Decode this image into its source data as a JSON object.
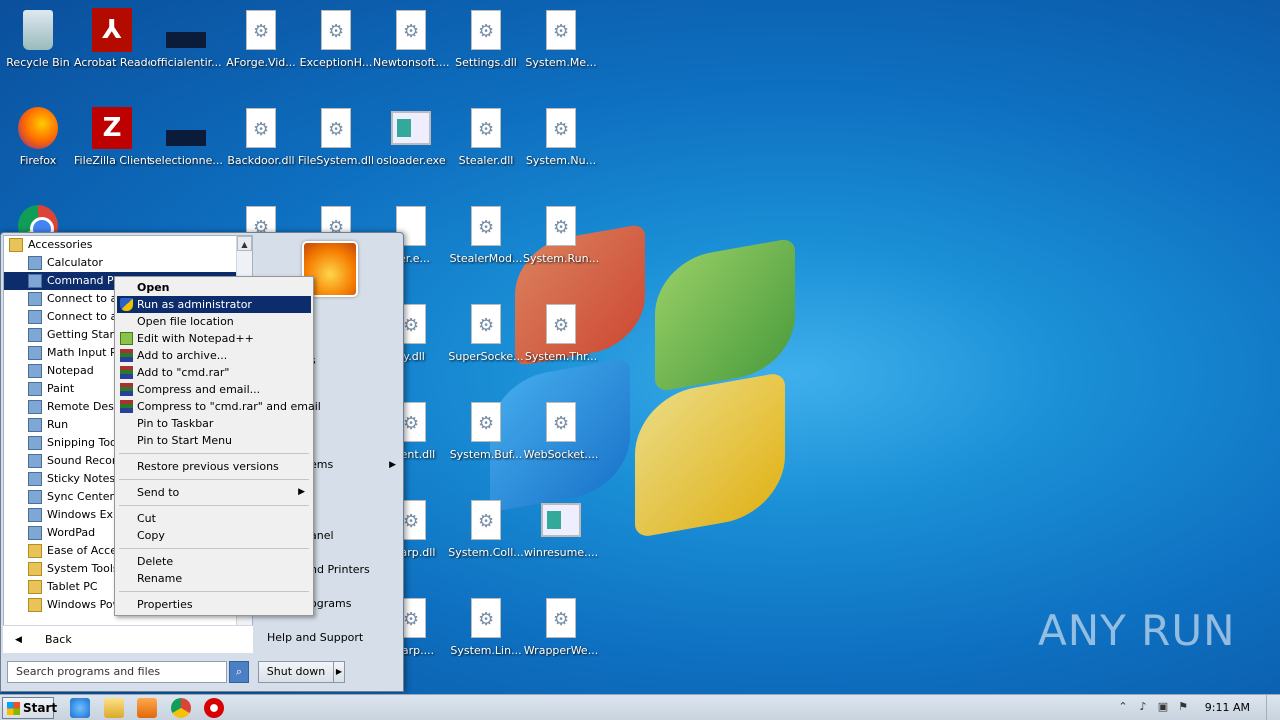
{
  "desktop": {
    "icons": [
      {
        "label": "Recycle Bin",
        "icon": "recycle-bin-icon",
        "kind": "bin"
      },
      {
        "label": "Acrobat Reader DC",
        "icon": "acrobat-icon",
        "kind": "pdf"
      },
      {
        "label": "officialentir...",
        "icon": "file-icon",
        "kind": "dark"
      },
      {
        "label": "AForge.Vid...",
        "icon": "dll-icon",
        "kind": "dll"
      },
      {
        "label": "ExceptionH...",
        "icon": "dll-icon",
        "kind": "dll"
      },
      {
        "label": "Newtonsoft....",
        "icon": "dll-icon",
        "kind": "dll"
      },
      {
        "label": "Settings.dll",
        "icon": "dll-icon",
        "kind": "dll"
      },
      {
        "label": "System.Me...",
        "icon": "dll-icon",
        "kind": "dll"
      },
      {
        "label": "Firefox",
        "icon": "firefox-icon",
        "kind": "ff"
      },
      {
        "label": "FileZilla Client",
        "icon": "filezilla-icon",
        "kind": "fz"
      },
      {
        "label": "selectionne...",
        "icon": "file-icon",
        "kind": "dark"
      },
      {
        "label": "Backdoor.dll",
        "icon": "dll-icon",
        "kind": "dll"
      },
      {
        "label": "FileSystem.dll",
        "icon": "dll-icon",
        "kind": "dll"
      },
      {
        "label": "osloader.exe",
        "icon": "exe-icon",
        "kind": "exe"
      },
      {
        "label": "Stealer.dll",
        "icon": "dll-icon",
        "kind": "dll"
      },
      {
        "label": "System.Nu...",
        "icon": "dll-icon",
        "kind": "dll"
      },
      {
        "label": "",
        "icon": "chrome-icon",
        "kind": "chrome"
      },
      {
        "label": "",
        "icon": "dll-icon",
        "kind": "dll"
      },
      {
        "label": "",
        "icon": "dll-icon",
        "kind": "dll"
      },
      {
        "label": "der.e...",
        "icon": "file-icon",
        "kind": "blank"
      },
      {
        "label": "StealerMod...",
        "icon": "dll-icon",
        "kind": "dll"
      },
      {
        "label": "System.Run...",
        "icon": "dll-icon",
        "kind": "dll"
      },
      {
        "label": "lly.dll",
        "icon": "dll-icon",
        "kind": "dll"
      },
      {
        "label": "SuperSocke...",
        "icon": "dll-icon",
        "kind": "dll"
      },
      {
        "label": "System.Thr...",
        "icon": "dll-icon",
        "kind": "dll"
      },
      {
        "label": "Client.dll",
        "icon": "dll-icon",
        "kind": "dll"
      },
      {
        "label": "System.Buf...",
        "icon": "dll-icon",
        "kind": "dll"
      },
      {
        "label": "WebSocket....",
        "icon": "dll-icon",
        "kind": "dll"
      },
      {
        "label": "Sharp.dll",
        "icon": "dll-icon",
        "kind": "dll"
      },
      {
        "label": "System.Coll...",
        "icon": "dll-icon",
        "kind": "dll"
      },
      {
        "label": "winresume....",
        "icon": "exe-icon",
        "kind": "exe"
      },
      {
        "label": "Sharp....",
        "icon": "dll-icon",
        "kind": "dll"
      },
      {
        "label": "System.Lin...",
        "icon": "dll-icon",
        "kind": "dll"
      },
      {
        "label": "WrapperWe...",
        "icon": "dll-icon",
        "kind": "dll"
      }
    ]
  },
  "start_menu": {
    "programs": [
      {
        "label": "Accessories",
        "type": "folder-top"
      },
      {
        "label": "Calculator",
        "type": "app"
      },
      {
        "label": "Command Prompt",
        "type": "app",
        "selected": true
      },
      {
        "label": "Connect to a Network Projector",
        "type": "app"
      },
      {
        "label": "Connect to a Projector",
        "type": "app"
      },
      {
        "label": "Getting Started",
        "type": "app"
      },
      {
        "label": "Math Input Panel",
        "type": "app"
      },
      {
        "label": "Notepad",
        "type": "app"
      },
      {
        "label": "Paint",
        "type": "app"
      },
      {
        "label": "Remote Desktop Connection",
        "type": "app"
      },
      {
        "label": "Run",
        "type": "app"
      },
      {
        "label": "Snipping Tool",
        "type": "app"
      },
      {
        "label": "Sound Recorder",
        "type": "app"
      },
      {
        "label": "Sticky Notes",
        "type": "app"
      },
      {
        "label": "Sync Center",
        "type": "app"
      },
      {
        "label": "Windows Explorer",
        "type": "app"
      },
      {
        "label": "WordPad",
        "type": "app"
      },
      {
        "label": "Ease of Access",
        "type": "folder"
      },
      {
        "label": "System Tools",
        "type": "folder"
      },
      {
        "label": "Tablet PC",
        "type": "folder"
      },
      {
        "label": "Windows PowerShell",
        "type": "folder"
      }
    ],
    "back_label": "Back",
    "search_placeholder": "Search programs and files",
    "right_items": [
      {
        "label": "s",
        "arrow": false
      },
      {
        "label": "ems",
        "arrow": true
      },
      {
        "label": "anel",
        "arrow": false
      },
      {
        "label": "nd Printers",
        "arrow": false
      },
      {
        "label": "ograms",
        "arrow": false
      },
      {
        "label": "Help and Support",
        "arrow": false
      }
    ],
    "shutdown_label": "Shut down"
  },
  "context_menu": {
    "groups": [
      [
        {
          "label": "Open",
          "bold": true
        },
        {
          "label": "Run as administrator",
          "icon": "shield-icon",
          "highlighted": true
        },
        {
          "label": "Open file location"
        },
        {
          "label": "Edit with Notepad++",
          "icon": "notepadpp-icon"
        },
        {
          "label": "Add to archive...",
          "icon": "winrar-icon"
        },
        {
          "label": "Add to \"cmd.rar\"",
          "icon": "winrar-icon"
        },
        {
          "label": "Compress and email...",
          "icon": "winrar-icon"
        },
        {
          "label": "Compress to \"cmd.rar\" and email",
          "icon": "winrar-icon"
        },
        {
          "label": "Pin to Taskbar"
        },
        {
          "label": "Pin to Start Menu"
        }
      ],
      [
        {
          "label": "Restore previous versions"
        }
      ],
      [
        {
          "label": "Send to",
          "submenu": true
        }
      ],
      [
        {
          "label": "Cut"
        },
        {
          "label": "Copy"
        }
      ],
      [
        {
          "label": "Delete"
        },
        {
          "label": "Rename"
        }
      ],
      [
        {
          "label": "Properties"
        }
      ]
    ]
  },
  "taskbar": {
    "start_label": "Start",
    "pinned": [
      "ie-icon",
      "explorer-icon",
      "media-player-icon",
      "chrome-icon",
      "opera-icon"
    ],
    "clock": "9:11 AM"
  },
  "watermark": "ANY RUN"
}
